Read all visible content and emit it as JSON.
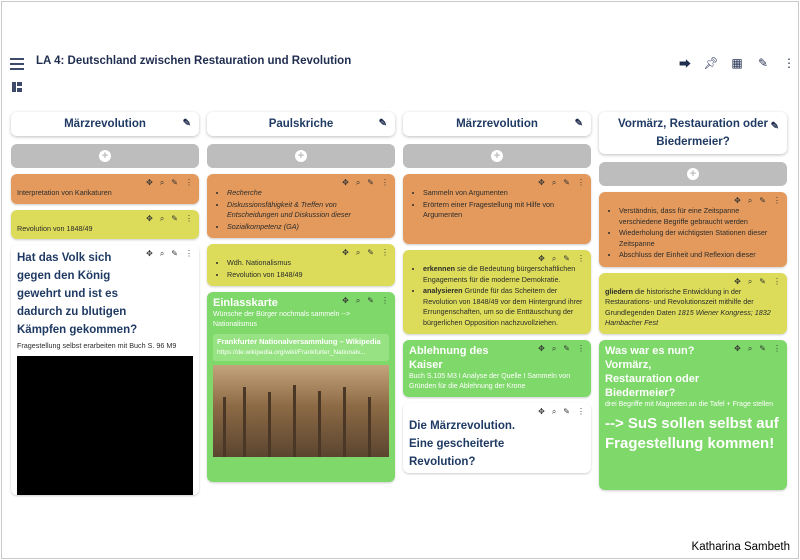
{
  "header": {
    "title": "LA 4: Deutschland zwischen Restauration und Revolution",
    "icons": [
      "share-icon",
      "pin-icon",
      "layout-icon",
      "edit-icon",
      "more-icon"
    ]
  },
  "columns": [
    {
      "title": "Märzrevolution",
      "cards": [
        {
          "color": "orange",
          "text": "Interpretation von Karikaturen"
        },
        {
          "color": "yellow",
          "text": "Revolution von 1848/49"
        },
        {
          "color": "white",
          "title": "Hat das Volk sich gegen den König gewehrt und ist es dadurch zu blutigen Kämpfen gekommen?",
          "note": "Fragestellung selbst erarbeiten mit Buch S. 96 M9"
        }
      ]
    },
    {
      "title": "Paulskriche",
      "cards": [
        {
          "color": "orange",
          "items": [
            "Recherche",
            "Diskussionsfähigkeit & Treffen von Entscheidungen und Diskussion dieser",
            "Sozialkompetenz (GA)"
          ]
        },
        {
          "color": "yellow",
          "items": [
            "Wdh. Nationalismus",
            "Revolution von 1848/49"
          ]
        },
        {
          "color": "green",
          "title": "Einlasskarte",
          "sub": "Wünsche der Bürger nochmals sammeln --> Nationalismus",
          "link_title": "Frankfurter Nationalversammlung – Wikipedia",
          "link_url": "https://de.wikipedia.org/wiki/Frankfurter_Nationalv..."
        }
      ]
    },
    {
      "title": "Märzrevolution",
      "cards": [
        {
          "color": "orange",
          "items": [
            "Sammeln von Argumenten",
            "Erörtern einer Fragestellung mit Hilfe von Argumenten"
          ]
        },
        {
          "color": "yellow",
          "items_rich": [
            {
              "bold": "erkennen",
              "rest": " sie die Bedeutung bürgerschaftlichen Engagements für die moderne Demokratie."
            },
            {
              "bold": "analysieren",
              "rest": " Gründe für das Scheitern der Revolution von 1848/49 vor dem Hintergrund ihrer Errungenschaften, um so die Enttäuschung der bürgerlichen Opposition nachzuvollziehen."
            }
          ]
        },
        {
          "color": "green",
          "title": "Ablehnung des Kaiser",
          "sub": "Buch S.105 M3 I Analyse der Quelle I Sammeln von Gründen für die Ablehnung der Krone"
        },
        {
          "color": "white",
          "title": "Die Märzrevolution. Eine gescheiterte Revolution?"
        }
      ]
    },
    {
      "title": "Vormärz, Restauration oder Biedermeier?",
      "cards": [
        {
          "color": "orange",
          "items": [
            "Verständnis, dass für eine Zeitspanne verschiedene Begriffe gebraucht werden",
            "Wiederholung der wichtigsten Stationen dieser Zeitspanne",
            "Abschluss der Einheit und Reflexion dieser"
          ]
        },
        {
          "color": "yellow",
          "rich": {
            "bold": "gliedern",
            "rest": " die historische Entwicklung in der Restaurations- und Revolutionszeit mithilfe der Grundlegenden Daten ",
            "italic": "1815 Wiener Kongress; 1832 Hambacher Fest"
          }
        },
        {
          "color": "green",
          "title": "Was war es nun? Vormärz, Restauration oder Biedermeier?",
          "sub": "drei Begriffe mit Magneten an die Tafel + Frage stellen",
          "huge": "--> SuS sollen selbst auf Fragestellung kommen!"
        }
      ]
    }
  ],
  "credit": "Katharina Sambeth"
}
